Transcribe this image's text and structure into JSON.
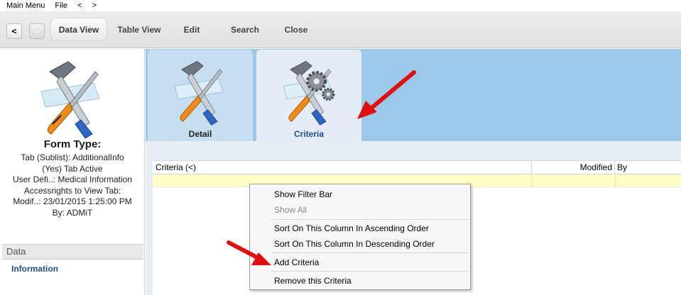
{
  "menubar": {
    "main_menu": "Main Menu",
    "file": "File",
    "back": "<",
    "forward": ">"
  },
  "toolbar": {
    "back_button": "<",
    "forward_button": ">",
    "data_view": "Data View",
    "table_view": "Table View",
    "edit": "Edit",
    "search": "Search",
    "close": "Close"
  },
  "left_panel": {
    "form_type_title": "Form Type:",
    "lines": [
      "Tab (Sublist): AdditionalInfo",
      "(Yes) Tab Active",
      "User Defi..: Medical Information",
      "Accessrights to View Tab:",
      "Modif..: 23/01/2015 1:25:00 PM",
      "By: ADMiT"
    ],
    "section_header": "Data",
    "section_item": "Information"
  },
  "tabs": [
    {
      "label": "Detail",
      "icon": "hammer-screwdriver-icon",
      "selected": false
    },
    {
      "label": "Criteria",
      "icon": "hammer-screwdriver-gears-icon",
      "selected": true
    }
  ],
  "grid": {
    "columns": [
      "Criteria (<)",
      "Modified",
      "By"
    ]
  },
  "context_menu": {
    "items": [
      {
        "label": "Show Filter Bar",
        "enabled": true
      },
      {
        "label": "Show All",
        "enabled": false
      },
      {
        "label": "Sort On This Column In Ascending Order",
        "enabled": true
      },
      {
        "label": "Sort On This Column In Descending Order",
        "enabled": true
      },
      {
        "label": "Add Criteria",
        "enabled": true
      },
      {
        "label": "Remove this Criteria",
        "enabled": true
      }
    ]
  },
  "colors": {
    "tab_strip_bg": "#9ec8ea",
    "selected_tab_bg": "#e4edf6",
    "link_blue": "#1f4e99",
    "row_highlight": "#ffffc6",
    "annotation_arrow": "#e01010"
  }
}
